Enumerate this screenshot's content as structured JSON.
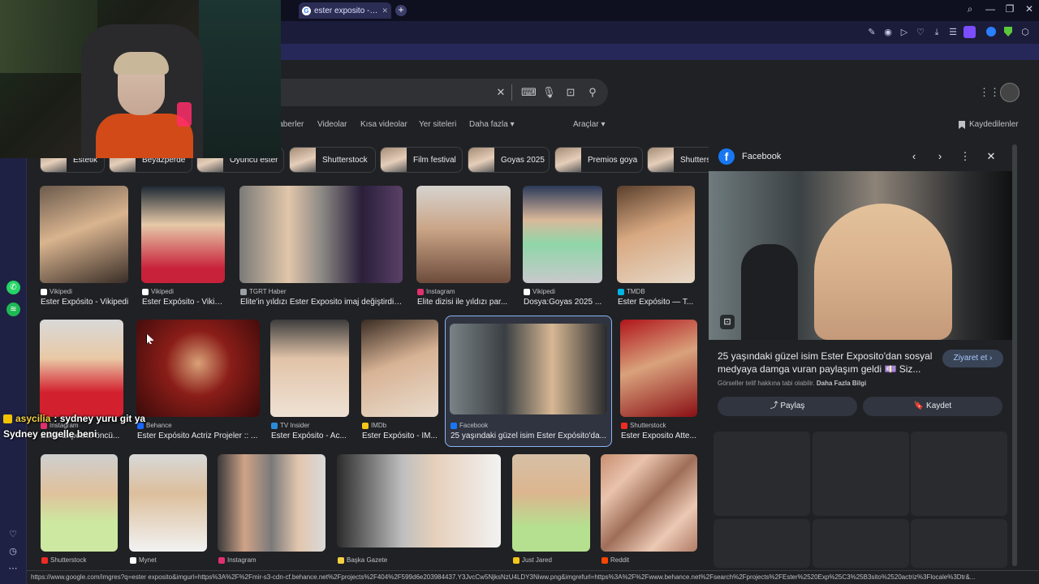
{
  "browser": {
    "active_tab": "ester exposito - Google'd",
    "new_tab_symbol": "+",
    "close_symbol": "x"
  },
  "search": {
    "tabs": [
      "Haberler",
      "Videolar",
      "Kısa videolar",
      "Yer siteleri",
      "Daha fazla ▾",
      "Araçlar ▾"
    ],
    "saved_label": "Kaydedilenler"
  },
  "chips": [
    "Estetik",
    "Beyazperde",
    "Oyuncu ester",
    "Shutterstock",
    "Film festival",
    "Goyas 2025",
    "Premios goya",
    "Shutters"
  ],
  "results": [
    {
      "source": "Vikipedi",
      "title": "Ester Expósito - Vikipedi",
      "fav": "#ffffff"
    },
    {
      "source": "Vikipedi",
      "title": "Ester Expósito - Vikip...",
      "fav": "#ffffff"
    },
    {
      "source": "TGRT Haber",
      "title": "Elite'in yıldızı Ester Exposito imaj değiştirdi! ...",
      "fav": "#9aa0a6"
    },
    {
      "source": "Instagram",
      "title": "Elite dizisi ile yıldızı par...",
      "fav": "#e1306c"
    },
    {
      "source": "Vikipedi",
      "title": "Dosya:Goyas 2025 ...",
      "fav": "#ffffff"
    },
    {
      "source": "TMDB",
      "title": "Ester Expósito — T...",
      "fav": "#01b4e4"
    },
    {
      "source": "Instagram",
      "title": "Ester Expósito öncü...",
      "fav": "#e1306c"
    },
    {
      "source": "Behance",
      "title": "Ester Expósito Actriz Projeler :: ...",
      "fav": "#1769ff"
    },
    {
      "source": "TV Insider",
      "title": "Ester Expósito - Ac...",
      "fav": "#2a8bd8"
    },
    {
      "source": "IMDb",
      "title": "Ester Expósito - IM...",
      "fav": "#f5c518"
    },
    {
      "source": "Facebook",
      "title": "25 yaşındaki güzel isim Ester Expósito'da...",
      "fav": "#1877f2"
    },
    {
      "source": "Shutterstock",
      "title": "Ester Exposito Atte...",
      "fav": "#ee2b24"
    },
    {
      "source": "Shutterstock",
      "title": "",
      "fav": "#ee2b24"
    },
    {
      "source": "Mynet",
      "title": "",
      "fav": "#ffffff"
    },
    {
      "source": "Instagram",
      "title": "",
      "fav": "#e1306c"
    },
    {
      "source": "Başka Gazete",
      "title": "",
      "fav": "#f5d142"
    },
    {
      "source": "Just Jared",
      "title": "",
      "fav": "#f5c518"
    },
    {
      "source": "Reddit",
      "title": "",
      "fav": "#ff4500"
    }
  ],
  "panel": {
    "source": "Facebook",
    "fb_letter": "f",
    "title": "25 yaşındaki güzel isim Ester Exposito'dan sosyal medyaya damga vuran paylaşım geldi 💷 Siz...",
    "visit_label": "Ziyaret et",
    "copyright_text": "Görseller telif hakkına tabi olabilir.",
    "copyright_link": "Daha Fazla Bilgi",
    "share_label": "Paylaş",
    "save_label": "Kaydet"
  },
  "chat": {
    "user": "asycilia",
    "message": ": sydney yuru git ya",
    "message2": "Sydney engelle beni"
  },
  "status_url": "https://www.google.com/imgres?q=ester exposito&imgurl=https%3A%2F%2Fmir-s3-cdn-cf.behance.net%2Fprojects%2F404%2F599d6e203984437.Y3JvcCw5NjksNzU4LDY3Niww.png&imgrefurl=https%3A%2F%2Fwww.behance.net%2Fsearch%2Fprojects%2FEster%2520Exp%25C3%25B3sito%2520actriz%3Flocale%3Dtr&..."
}
